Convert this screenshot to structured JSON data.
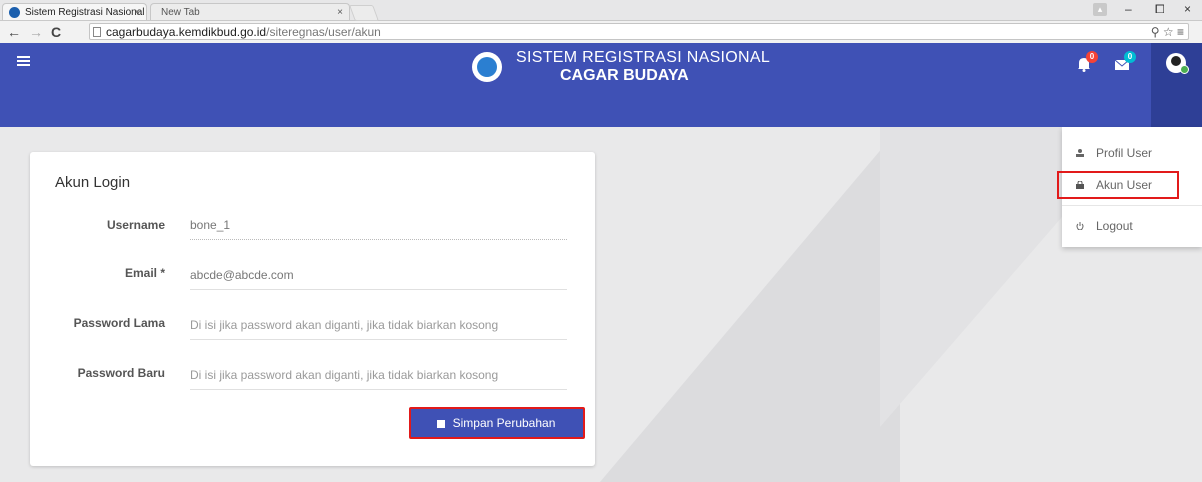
{
  "browser": {
    "tabs": [
      {
        "title": "Sistem Registrasi Nasional",
        "close": "×"
      },
      {
        "title": "New Tab",
        "close": "×"
      }
    ],
    "window_controls": {
      "minimize": "–",
      "maximize": "⧠",
      "close": "×"
    },
    "nav": {
      "back": "←",
      "forward": "→",
      "reload": "C"
    },
    "url": {
      "host": "cagarbudaya.kemdikbud.go.id",
      "path": "/siteregnas/user/akun"
    },
    "omni_icons": "⚲ ☆ ≡"
  },
  "header": {
    "title_line1": "SISTEM REGISTRASI NASIONAL",
    "title_line2": "CAGAR BUDAYA",
    "notifications_badge": "0",
    "messages_badge": "0",
    "colors": {
      "bar": "#3f51b5",
      "badge_red": "#f44336",
      "badge_teal": "#00bcd4"
    }
  },
  "form": {
    "title": "Akun Login",
    "fields": [
      {
        "label": "Username",
        "value": "bone_1"
      },
      {
        "label": "Email *",
        "value": "abcde@abcde.com"
      },
      {
        "label": "Password Lama",
        "placeholder": "Di isi jika password akan diganti, jika tidak biarkan kosong"
      },
      {
        "label": "Password Baru",
        "placeholder": "Di isi jika password akan diganti, jika tidak biarkan kosong"
      }
    ],
    "submit_label": "Simpan Perubahan"
  },
  "user_menu": {
    "items": [
      {
        "label": "Profil User",
        "icon": "person-icon"
      },
      {
        "label": "Akun User",
        "icon": "lock-icon"
      },
      {
        "label": "Logout",
        "icon": "power-icon"
      }
    ]
  }
}
